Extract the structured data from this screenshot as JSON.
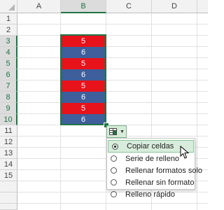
{
  "columns": [
    "A",
    "B",
    "C",
    "D"
  ],
  "selected_column": "B",
  "rows": [
    "1",
    "2",
    "3",
    "4",
    "5",
    "6",
    "7",
    "8",
    "9",
    "10",
    "11",
    "12",
    "13",
    "14",
    "15"
  ],
  "selected_rows": [
    "3",
    "4",
    "5",
    "6",
    "7",
    "8",
    "9",
    "10"
  ],
  "cells": [
    {
      "row": "3",
      "value": "5",
      "color": "#e8121b"
    },
    {
      "row": "4",
      "value": "6",
      "color": "#3e5f9b"
    },
    {
      "row": "5",
      "value": "5",
      "color": "#e8121b"
    },
    {
      "row": "6",
      "value": "6",
      "color": "#3e5f9b"
    },
    {
      "row": "7",
      "value": "5",
      "color": "#e8121b"
    },
    {
      "row": "8",
      "value": "6",
      "color": "#3e5f9b"
    },
    {
      "row": "9",
      "value": "5",
      "color": "#e8121b"
    },
    {
      "row": "10",
      "value": "6",
      "color": "#3e5f9b"
    }
  ],
  "autofill_menu": {
    "button_icon": "autofill-options-icon",
    "items": [
      {
        "label": "Copiar celdas",
        "selected": true
      },
      {
        "label": "Serie de relleno",
        "selected": false
      },
      {
        "label": "Rellenar formatos solo",
        "selected": false
      },
      {
        "label": "Rellenar sin formato",
        "selected": false
      },
      {
        "label": "Relleno rápido",
        "selected": false
      }
    ]
  },
  "colors": {
    "selection": "#217346",
    "red": "#e8121b",
    "blue": "#3e5f9b"
  }
}
